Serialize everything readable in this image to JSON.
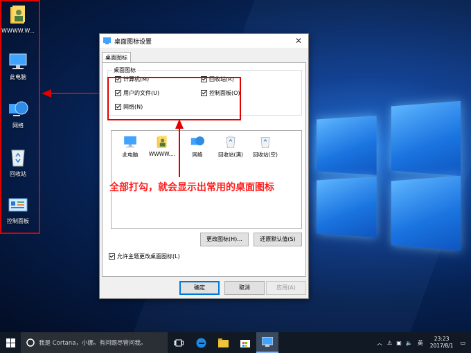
{
  "desktop": {
    "icons": [
      {
        "label": "WWWW.W...",
        "icon": "user-folder-icon"
      },
      {
        "label": "此电脑",
        "icon": "computer-icon"
      },
      {
        "label": "网络",
        "icon": "network-icon"
      },
      {
        "label": "回收站",
        "icon": "recycle-bin-icon"
      },
      {
        "label": "控制面板",
        "icon": "control-panel-icon"
      }
    ]
  },
  "dialog": {
    "title": "桌面图标设置",
    "close": "✕",
    "tab": "桌面图标",
    "group_label": "桌面图标",
    "checkboxes": {
      "computer": "计算机(M)",
      "recycle": "回收站(R)",
      "user_files": "用户的文件(U)",
      "control_panel": "控制面板(O)",
      "network": "网络(N)"
    },
    "icon_list": [
      {
        "label": "此电脑",
        "icon": "computer-icon"
      },
      {
        "label": "WWWW....",
        "icon": "user-folder-icon"
      },
      {
        "label": "网络",
        "icon": "network-icon"
      },
      {
        "label": "回收站(满)",
        "icon": "recycle-bin-full-icon"
      },
      {
        "label": "回收站(空)",
        "icon": "recycle-bin-empty-icon"
      }
    ],
    "change_icon": "更改图标(H)...",
    "restore_default": "还原默认值(S)",
    "allow_themes": "允许主题更改桌面图标(L)",
    "ok": "确定",
    "cancel": "取消",
    "apply": "应用(A)"
  },
  "annotation": "全部打勾，就会显示出常用的桌面图标",
  "taskbar": {
    "search_placeholder": "我是 Cortana，小娜。有问题尽管问我。",
    "ime": "英",
    "time": "23:23",
    "date": "2017/8/1"
  },
  "colors": {
    "annotation_red": "#e00000",
    "accent": "#0078d7"
  }
}
